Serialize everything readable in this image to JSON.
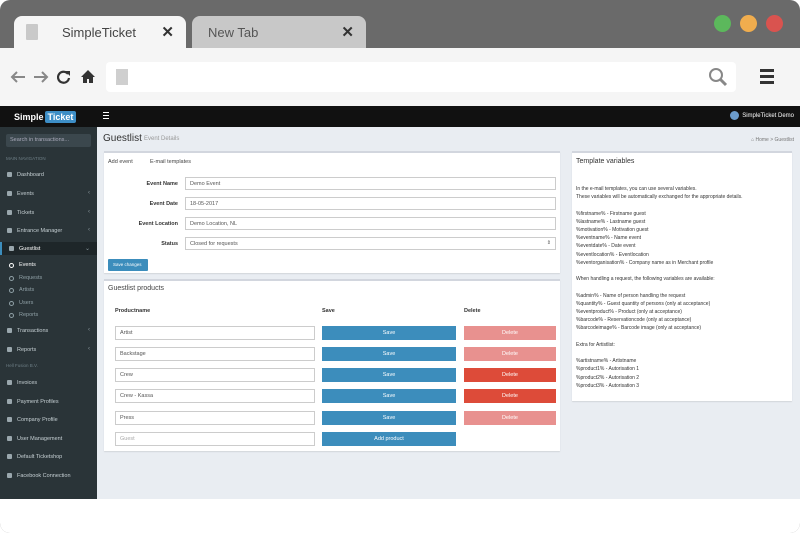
{
  "browser": {
    "tabs": [
      {
        "title": "SimpleTicket"
      },
      {
        "title": "New Tab"
      }
    ],
    "close_glyph": "✕",
    "window_buttons": [
      "#5cb85c",
      "#f0ad4e",
      "#d9534f"
    ]
  },
  "app": {
    "logo": {
      "left": "Simple",
      "right": "Ticket"
    },
    "user": "SimpleTicket Demo",
    "sidebar": {
      "search_placeholder": "Search in transactions...",
      "main_header": "MAIN NAVIGATION",
      "items": [
        "Dashboard",
        "Events",
        "Tickets",
        "Entrance Manager",
        "Guestlist"
      ],
      "guestlist_sub": [
        "Events",
        "Requests",
        "Artists",
        "Users",
        "Reports"
      ],
      "items2": [
        "Transactions",
        "Reports"
      ],
      "second_header": "Hell Fusion B.V.",
      "items3": [
        "Invoices",
        "Payment Profiles",
        "Company Profile",
        "User Management",
        "Default Ticketshop",
        "Facebook Connection"
      ]
    },
    "page": {
      "title": "Guestlist",
      "subtitle": "Event Details",
      "breadcrumb_home": "Home",
      "breadcrumb_current": "Guestlist"
    },
    "form": {
      "tabs": [
        "Add event",
        "E-mail templates"
      ],
      "event_name_label": "Event Name",
      "event_name": "Demo Event",
      "event_date_label": "Event Date",
      "event_date": "18-05-2017",
      "event_location_label": "Event Location",
      "event_location": "Demo Location, NL",
      "status_label": "Status",
      "status": "Closed for requests",
      "save_changes": "Save changes"
    },
    "products": {
      "title": "Guestlist products",
      "headers": [
        "Productname",
        "Save",
        "Delete"
      ],
      "rows": [
        {
          "name": "Artist",
          "save": "Save",
          "delete": "Delete",
          "del_color": "#e8918f"
        },
        {
          "name": "Backstage",
          "save": "Save",
          "delete": "Delete",
          "del_color": "#e8918f"
        },
        {
          "name": "Crew",
          "save": "Save",
          "delete": "Delete",
          "del_color": "#dd4b39"
        },
        {
          "name": "Crew - Kassa",
          "save": "Save",
          "delete": "Delete",
          "del_color": "#dd4b39"
        },
        {
          "name": "Press",
          "save": "Save",
          "delete": "Delete",
          "del_color": "#e8918f"
        }
      ],
      "new_placeholder": "Guest",
      "add_product": "Add product"
    },
    "variables": {
      "title": "Template variables",
      "text": "In the e-mail templates, you can use several variables.\nThese variables will be automatically exchanged for the appropriate details.\n\n%firstname% - Firstname guest\n%lastname% - Lastname guest\n%motivation% - Motivation guest\n%eventname% - Name event\n%eventdate% - Date event\n%eventlocation% - Eventlocation\n%eventorganisation% - Company name as in Merchant profile\n\nWhen handling a request, the following variables are available:\n\n%admin% - Name of person handling the request\n%quantity% - Guest quantity of persons (only at acceptance)\n%eventproduct% - Product (only at acceptance)\n%barcode% - Reservationcode (only at acceptance)\n%barcodeimage% - Barcode image (only at acceptance)\n\nExtra for Artistlist:\n\n%artistname% - Artistname\n%product1% - Autorisation 1\n%product2% - Autorisation 2\n%product3% - Autorisation 3"
    }
  }
}
